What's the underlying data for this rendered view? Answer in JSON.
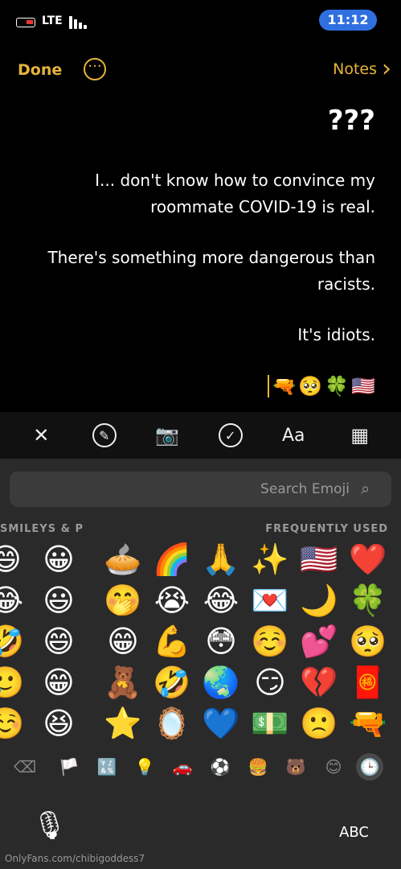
{
  "status": {
    "time": "11:12",
    "carrier": "LTE"
  },
  "nav": {
    "back_label": "Notes",
    "done_label": "Done"
  },
  "note": {
    "title": "???",
    "paragraphs": [
      "I... don't know how to convince my roommate COVID-19 is real.",
      "There's something more dangerous than racists.",
      "It's idiots."
    ],
    "emoji_line": [
      "🇺🇸",
      "🍀",
      "🥺",
      "🔫"
    ]
  },
  "keyboard": {
    "search_placeholder": "Search Emoji",
    "section_frequent": "FREQUENTLY USED",
    "section_smileys": "SMILEYS & P",
    "abc_label": "ABC",
    "watermark": "OnlyFans.com/chibigoddess7",
    "frequent": [
      [
        "❤️",
        "🇺🇸",
        "✨",
        "🙏",
        "🌈",
        "🥧"
      ],
      [
        "🍀",
        "🌙",
        "💌",
        "😂",
        "😭",
        "🤭"
      ],
      [
        "🥺",
        "💕",
        "☺️",
        "😳",
        "💪",
        "😁"
      ],
      [
        "🧧",
        "💔",
        "😏",
        "🌏",
        "🤣",
        "🧸"
      ],
      [
        "🔫",
        "🙁",
        "💵",
        "💙",
        "🪞",
        "⭐"
      ]
    ],
    "smileys": [
      [
        "😀",
        "😄"
      ],
      [
        "😃",
        "😂"
      ],
      [
        "😄",
        "🤣"
      ],
      [
        "😁",
        "🥲"
      ],
      [
        "😆",
        "☺️"
      ]
    ],
    "categories": [
      "🕒",
      "😊",
      "🐻",
      "🍔",
      "⚽",
      "🚗",
      "💡",
      "🔣",
      "🏳️",
      "⌫"
    ]
  }
}
